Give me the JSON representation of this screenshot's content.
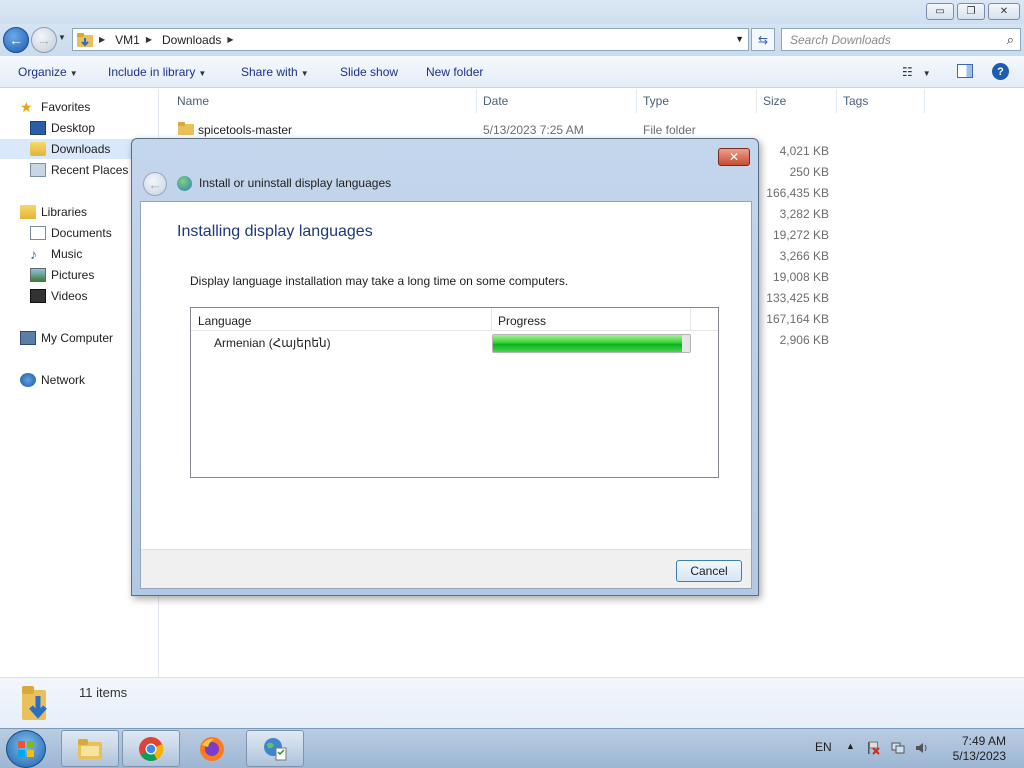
{
  "window": {
    "min_glyph": "▭",
    "max_glyph": "❐",
    "close_glyph": "✕"
  },
  "address": {
    "segments": [
      "VM1",
      "Downloads"
    ],
    "search_placeholder": "Search Downloads"
  },
  "toolbar": {
    "organize": "Organize",
    "include": "Include in library",
    "share": "Share with",
    "slideshow": "Slide show",
    "new_folder": "New folder",
    "help": "?"
  },
  "nav": {
    "favorites": "Favorites",
    "desktop": "Desktop",
    "downloads": "Downloads",
    "recent": "Recent Places",
    "libraries": "Libraries",
    "documents": "Documents",
    "music": "Music",
    "pictures": "Pictures",
    "videos": "Videos",
    "computer": "My Computer",
    "network": "Network"
  },
  "columns": {
    "name": "Name",
    "date": "Date",
    "type": "Type",
    "size": "Size",
    "tags": "Tags"
  },
  "files": [
    {
      "name": "spicetools-master",
      "date": "5/13/2023 7:25 AM",
      "type": "File folder",
      "size": ""
    }
  ],
  "sizes": [
    "4,021 KB",
    "250 KB",
    "166,435 KB",
    "3,282 KB",
    "19,272 KB",
    "3,266 KB",
    "19,008 KB",
    "133,425 KB",
    "167,164 KB",
    "2,906 KB"
  ],
  "details": {
    "count": "11 items"
  },
  "dialog": {
    "title": "Install or uninstall display languages",
    "heading": "Installing display languages",
    "description": "Display language installation may take a long time on some computers.",
    "col_language": "Language",
    "col_progress": "Progress",
    "row_language": "Armenian (Հայերեն)",
    "progress_fraction": 0.96,
    "cancel": "Cancel",
    "close_glyph": "✕"
  },
  "taskbar": {
    "lang": "EN",
    "time": "7:49 AM",
    "date": "5/13/2023"
  }
}
